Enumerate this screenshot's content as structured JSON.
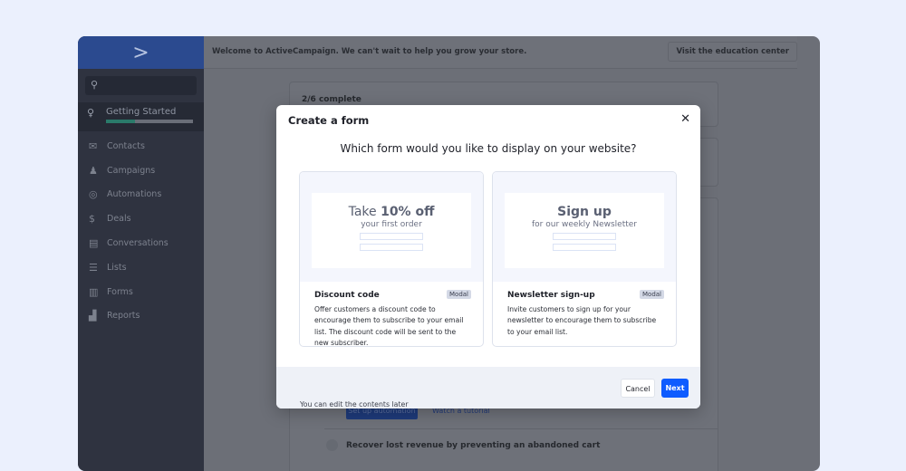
{
  "sidebar": {
    "logo": "ActiveCampaign",
    "search_icon": "search-icon",
    "getting_started": {
      "label": "Getting Started",
      "progress_percent": 33
    },
    "items": [
      {
        "label": "Contacts",
        "icon": "envelope-icon"
      },
      {
        "label": "Campaigns",
        "icon": "megaphone-icon"
      },
      {
        "label": "Automations",
        "icon": "automation-icon"
      },
      {
        "label": "Deals",
        "icon": "dollar-icon"
      },
      {
        "label": "Conversations",
        "icon": "chat-icon"
      },
      {
        "label": "Lists",
        "icon": "list-icon"
      },
      {
        "label": "Forms",
        "icon": "form-icon"
      },
      {
        "label": "Reports",
        "icon": "chart-icon"
      }
    ]
  },
  "header": {
    "welcome": "Welcome to ActiveCampaign. We can't wait to help you grow your store.",
    "education_button": "Visit the education center"
  },
  "background": {
    "progress": "2/6 complete",
    "setup_button": "Set up automation",
    "tutorial_link": "Watch a tutorial",
    "task": "Recover lost revenue by preventing an abandoned cart"
  },
  "modal": {
    "title": "Create a form",
    "question": "Which form would you like to display on your website?",
    "cards": [
      {
        "preview_prefix": "Take ",
        "preview_bold": "10% off",
        "preview_sub": "your first order",
        "name": "Discount code",
        "badge": "Modal",
        "description": "Offer customers a discount code to encourage them to subscribe to your email list. The discount code will be sent to the new subscriber."
      },
      {
        "preview_prefix": "",
        "preview_bold": "Sign up",
        "preview_sub": "for our weekly Newsletter",
        "name": "Newsletter sign-up",
        "badge": "Modal",
        "description": "Invite customers to sign up for your newsletter to encourage them to subscribe to your email list."
      }
    ],
    "hint": "You can edit the contents later",
    "cancel": "Cancel",
    "next": "Next"
  },
  "colors": {
    "primary": "#0e5cff",
    "sidebar": "#2f3340"
  }
}
